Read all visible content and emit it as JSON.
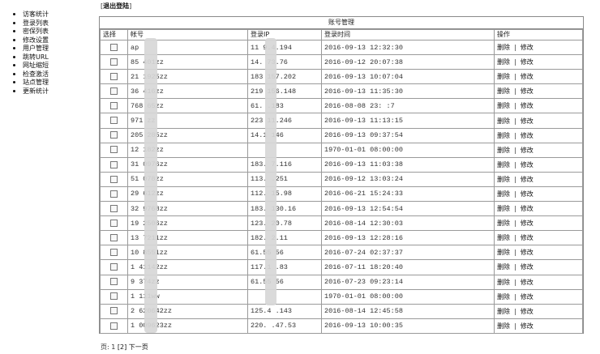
{
  "sidebar": {
    "items": [
      "访客统计",
      "登录列表",
      "密保列表",
      "修改设置",
      "用户管理",
      "跳转URL",
      "网址缩短",
      "检查激活",
      "站点管理",
      "更新统计"
    ]
  },
  "topbar": {
    "logout_label": "退出登陆"
  },
  "panel": {
    "title": "账号管理",
    "columns": [
      "选择",
      "帐号",
      "登录IP",
      "登录时间",
      "操作"
    ],
    "rows": [
      {
        "account": "ap",
        "ip": "11 9.4.194",
        "time": "2016-09-13 12:32:30"
      },
      {
        "account": "85 401zz",
        "ip": "14. 73.76",
        "time": "2016-09-12 20:07:38"
      },
      {
        "account": "21 1925zz",
        "ip": "183 157.202",
        "time": "2016-09-13 10:07:04"
      },
      {
        "account": "36 416zz",
        "ip": "219 156.148",
        "time": "2016-09-13 11:35:30"
      },
      {
        "account": "768 65zz",
        "ip": "61. .183",
        "time": "2016-08-08 23: :7"
      },
      {
        "account": "971 zz",
        "ip": "223 11.246",
        "time": "2016-09-13 11:13:15"
      },
      {
        "account": "205 285zz",
        "ip": "14.1 146",
        "time": "2016-09-13 09:37:54"
      },
      {
        "account": "12 182zz",
        "ip": "",
        "time": "1970-01-01 08:00:00"
      },
      {
        "account": "31 0976zz",
        "ip": "183. 7.116",
        "time": "2016-09-13 11:03:38"
      },
      {
        "account": "51 078zz",
        "ip": "113. .251",
        "time": "2016-09-12 13:03:24"
      },
      {
        "account": "29 612zz",
        "ip": "112. 15.98",
        "time": "2016-06-21 15:24:33"
      },
      {
        "account": "32 9768zz",
        "ip": "183. 130.16",
        "time": "2016-09-13 12:54:54"
      },
      {
        "account": "19 2506zz",
        "ip": "123. 20.78",
        "time": "2016-08-14 12:30:03"
      },
      {
        "account": "13 7211zz",
        "ip": "182. 2.11",
        "time": "2016-09-13 12:28:16"
      },
      {
        "account": "10 8551zz",
        "ip": "61.55 56",
        "time": "2016-07-24 02:37:37"
      },
      {
        "account": "1 41142zz",
        "ip": "117.1 .83",
        "time": "2016-07-11 18:20:40"
      },
      {
        "account": "9 374zz",
        "ip": "61.55 56",
        "time": "2016-07-23 09:23:14"
      },
      {
        "account": "1 111ww",
        "ip": "",
        "time": "1970-01-01 08:00:00"
      },
      {
        "account": "2 620642zz",
        "ip": "125.4 .143",
        "time": "2016-08-14 12:45:58"
      },
      {
        "account": "1 009623zz",
        "ip": "220. .47.53",
        "time": "2016-09-13 10:00:35"
      }
    ],
    "delete_label": "删除",
    "separator": "|",
    "edit_label": "修改"
  },
  "pager": {
    "prefix": "页: 1 ",
    "page2": "[2]",
    "next": "下一页"
  }
}
